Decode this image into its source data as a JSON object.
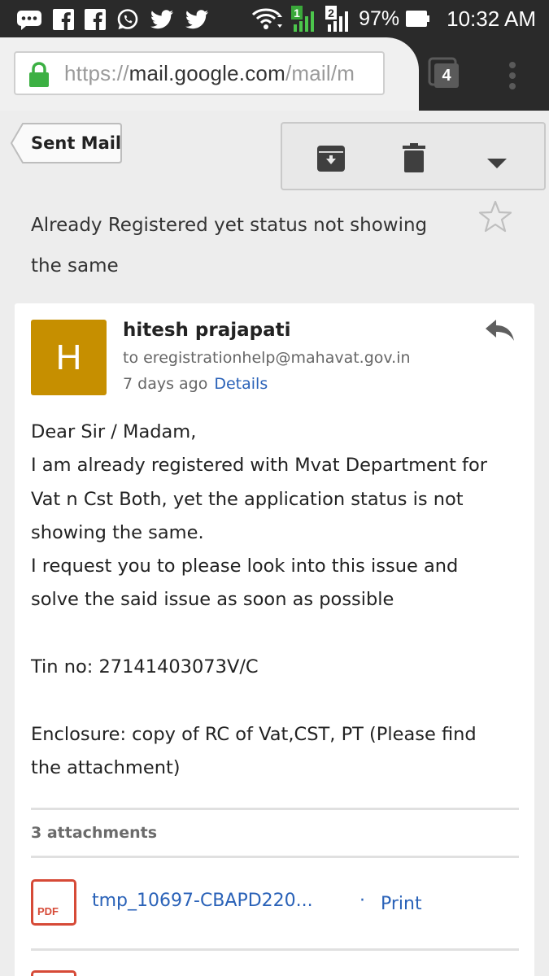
{
  "status_bar": {
    "battery": "97%",
    "time": "10:32 AM",
    "sim1": "1",
    "sim2": "2",
    "icons": [
      "messages-icon",
      "facebook-icon",
      "facebook-icon",
      "whatsapp-icon",
      "twitter-icon",
      "twitter-icon",
      "wifi-icon",
      "signal-icon",
      "signal-icon",
      "battery-icon"
    ]
  },
  "browser": {
    "url_prefix": "https://",
    "url_host": "mail.google.com",
    "url_path": "/mail/m",
    "tab_count": "4"
  },
  "nav": {
    "back_label": "Sent Mail"
  },
  "toolbar": {
    "actions": [
      "archive-icon",
      "delete-icon",
      "more-icon"
    ]
  },
  "message": {
    "subject": "Already Registered yet status not showing the same",
    "avatar_letter": "H",
    "avatar_color": "#c68f00",
    "sender": "hitesh prajapati",
    "recipient": "to eregistrationhelp@mahavat.gov.in",
    "date": "7 days ago",
    "details_label": "Details",
    "body_lines": [
      "Dear Sir / Madam,",
      "I am already registered with Mvat Department for",
      "Vat n Cst Both, yet the application status is not",
      "showing the same.",
      "I request you to please look into this issue and",
      "solve the said issue as soon as possible",
      "",
      "Tin no: 27141403073V/C",
      "",
      "Enclosure: copy of RC of Vat,CST, PT (Please find",
      "the attachment)"
    ],
    "attachments_count_label": "3 attachments",
    "attachments": [
      {
        "type": "PDF",
        "name": "tmp_10697-CBAPD220...",
        "print_label": "Print",
        "separator": "·"
      }
    ]
  },
  "colors": {
    "link": "#2a62b8",
    "pdf_red": "#d64a37",
    "status_bar_bg": "#2a2a2a",
    "page_bg": "#ededed"
  }
}
